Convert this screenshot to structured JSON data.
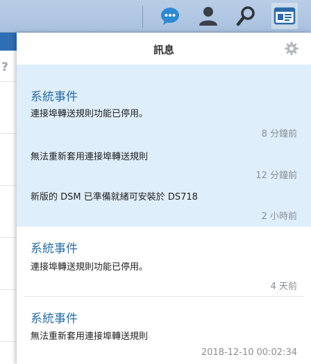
{
  "taskbar": {
    "icons": [
      "chat-icon",
      "user-icon",
      "search-icon",
      "notification-card-icon"
    ],
    "accent": "#2d89d0"
  },
  "panel": {
    "title": "訊息",
    "settings_icon": "gear-icon",
    "group_bg": "#dfeefb",
    "group": {
      "title": "系統事件",
      "items": [
        {
          "message": "連接埠轉送規則功能已停用。",
          "time": "8 分鐘前"
        },
        {
          "message": "無法重新套用連接埠轉送規則",
          "time": "12 分鐘前"
        },
        {
          "message": "新版的 DSM 已準備就緒可安裝於 DS718",
          "time": "2 小時前"
        }
      ]
    },
    "notifications": [
      {
        "title": "系統事件",
        "message": "連接埠轉送規則功能已停用。",
        "time": "4 天前"
      },
      {
        "title": "系統事件",
        "message": "無法重新套用連接埠轉送規則",
        "time": "2018-12-10 00:02:34"
      }
    ]
  }
}
